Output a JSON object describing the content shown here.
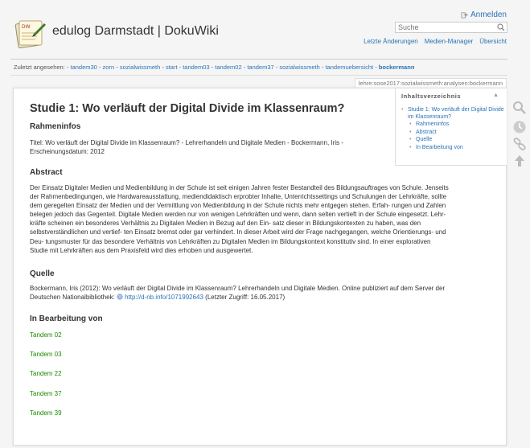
{
  "header": {
    "site_title": "edulog Darmstadt | DokuWiki",
    "login": "Anmelden",
    "search_placeholder": "Suche",
    "links": [
      "Letzte Änderungen",
      "Medien-Manager",
      "Übersicht"
    ]
  },
  "breadcrumbs": {
    "label": "Zuletzt angesehen:",
    "items": [
      "tandem30",
      "zorn",
      "sozialwissmeth",
      "start",
      "tandem03",
      "tandem02",
      "tandem37",
      "sozialwissmeth",
      "tandemuebersicht"
    ],
    "current": "bockermann"
  },
  "page_id": "lehre:sose2017:sozialwissmeth:analysen:bockermann",
  "toc": {
    "title": "Inhaltsverzeichnis",
    "items": [
      "Studie 1: Wo verläuft der Digital Divide im Klassenraum?",
      "Rahmeninfos",
      "Abstract",
      "Quelle",
      "In Bearbeitung von"
    ]
  },
  "article": {
    "title": "Studie 1: Wo verläuft der Digital Divide im Klassenraum?",
    "h_rahmen": "Rahmeninfos",
    "rahmen_text": "Titel: Wo verläuft der Digital Divide im Klassenraum? - Lehrerhandeln und Digitale Medien - Bockermann, Iris - Erscheinungsdatum: 2012",
    "h_abstract": "Abstract",
    "abstract_lines": [
      "Der Einsatz Digitaler Medien und Medienbildung in der Schule ist seit einigen Jahren fester Bestandteil des Bildungsauftrages von Schule. Jenseits",
      "der Rahmenbedingungen, wie Hardwareausstattung, mediendidaktisch erprobter Inhalte, Unterrichtssettings und Schulungen der Lehrkräfte, sollte",
      "dem geregelten Einsatz der Medien und der Vermittlung von Medienbildung in der Schule nichts mehr entgegen stehen. Erfah- rungen und Zahlen",
      "belegen jedoch das Gegenteil. Digitale Medien werden nur von wenigen Lehrkräften und wenn, dann selten vertieft in der Schule eingesetzt. Lehr-",
      "kräfte scheinen ein besonderes Verhältnis zu Digitalen Medien in Bezug auf den Ein- satz dieser in Bildungskontexten zu haben, was den",
      "selbstverständlichen und vertief- ten Einsatz bremst oder gar verhindert. In dieser Arbeit wird der Frage nachgegangen, welche Orientierungs- und",
      "Deu- tungsmuster für das besondere Verhältnis von Lehrkräften zu Digitalen Medien im Bildungskontext konstitutiv sind. In einer explorativen",
      "Studie mit Lehrkräften aus dem Praxisfeld wird dies erhoben und ausgewertet."
    ],
    "h_quelle": "Quelle",
    "quelle_line1": "Bockermann, Iris (2012): Wo verläuft der Digital Divide im Klassenraum? Lehrerhandeln und Digitale Medien. Online publiziert auf dem Server der",
    "quelle_line2_pre": "Deutschen Nationalbibliothek:",
    "quelle_link": "http://d-nb.info/1071992643",
    "quelle_line2_post": "(Letzter Zugriff: 16.05.2017)",
    "h_bearbeitung": "In Bearbeitung von",
    "tandems": [
      "Tandem 02",
      "Tandem 03",
      "Tandem 22",
      "Tandem 37",
      "Tandem 39"
    ]
  },
  "tools": [
    "search-icon",
    "history-icon",
    "backlinks-icon",
    "back-to-top-icon"
  ],
  "colors": {
    "link": "#2b73b7",
    "tandem_link": "#1c8a00"
  }
}
